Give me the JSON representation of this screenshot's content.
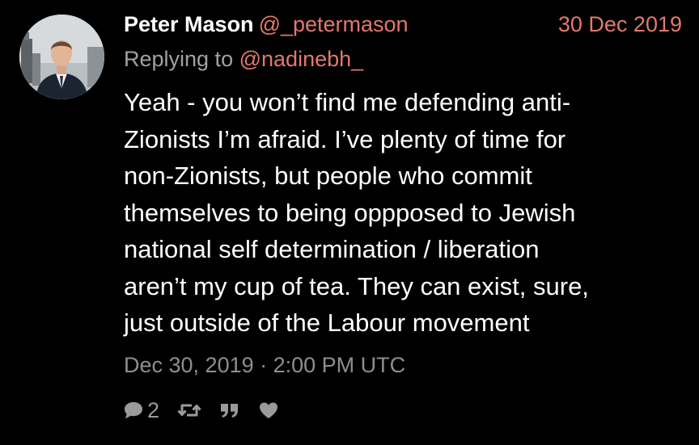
{
  "tweet": {
    "author": {
      "name": "Peter Mason",
      "handle": "@_petermason"
    },
    "date": "30 Dec 2019",
    "replying": {
      "prefix": "Replying to",
      "handle": "@nadinebh_"
    },
    "body_lines": [
      "Yeah - you won’t find me defending anti-",
      "Zionists I’m afraid. I’ve plenty of time for",
      "non-Zionists, but people who commit",
      "themselves to being oppposed to Jewish",
      "national self determination / liberation",
      "aren’t my cup of tea. They can exist, sure,",
      "just outside of the Labour movement"
    ],
    "timestamp": "Dec 30, 2019 · 2:00 PM UTC",
    "stats": {
      "replies": "2"
    },
    "icons": {
      "reply": "comment-icon",
      "retweet": "retweet-icon",
      "quote": "quote-icon",
      "like": "heart-icon"
    },
    "colors": {
      "background": "#000000",
      "text": "#ffffff",
      "accent": "#e3786b",
      "muted": "#a2a2a2",
      "icon": "#9a9a9a"
    }
  }
}
